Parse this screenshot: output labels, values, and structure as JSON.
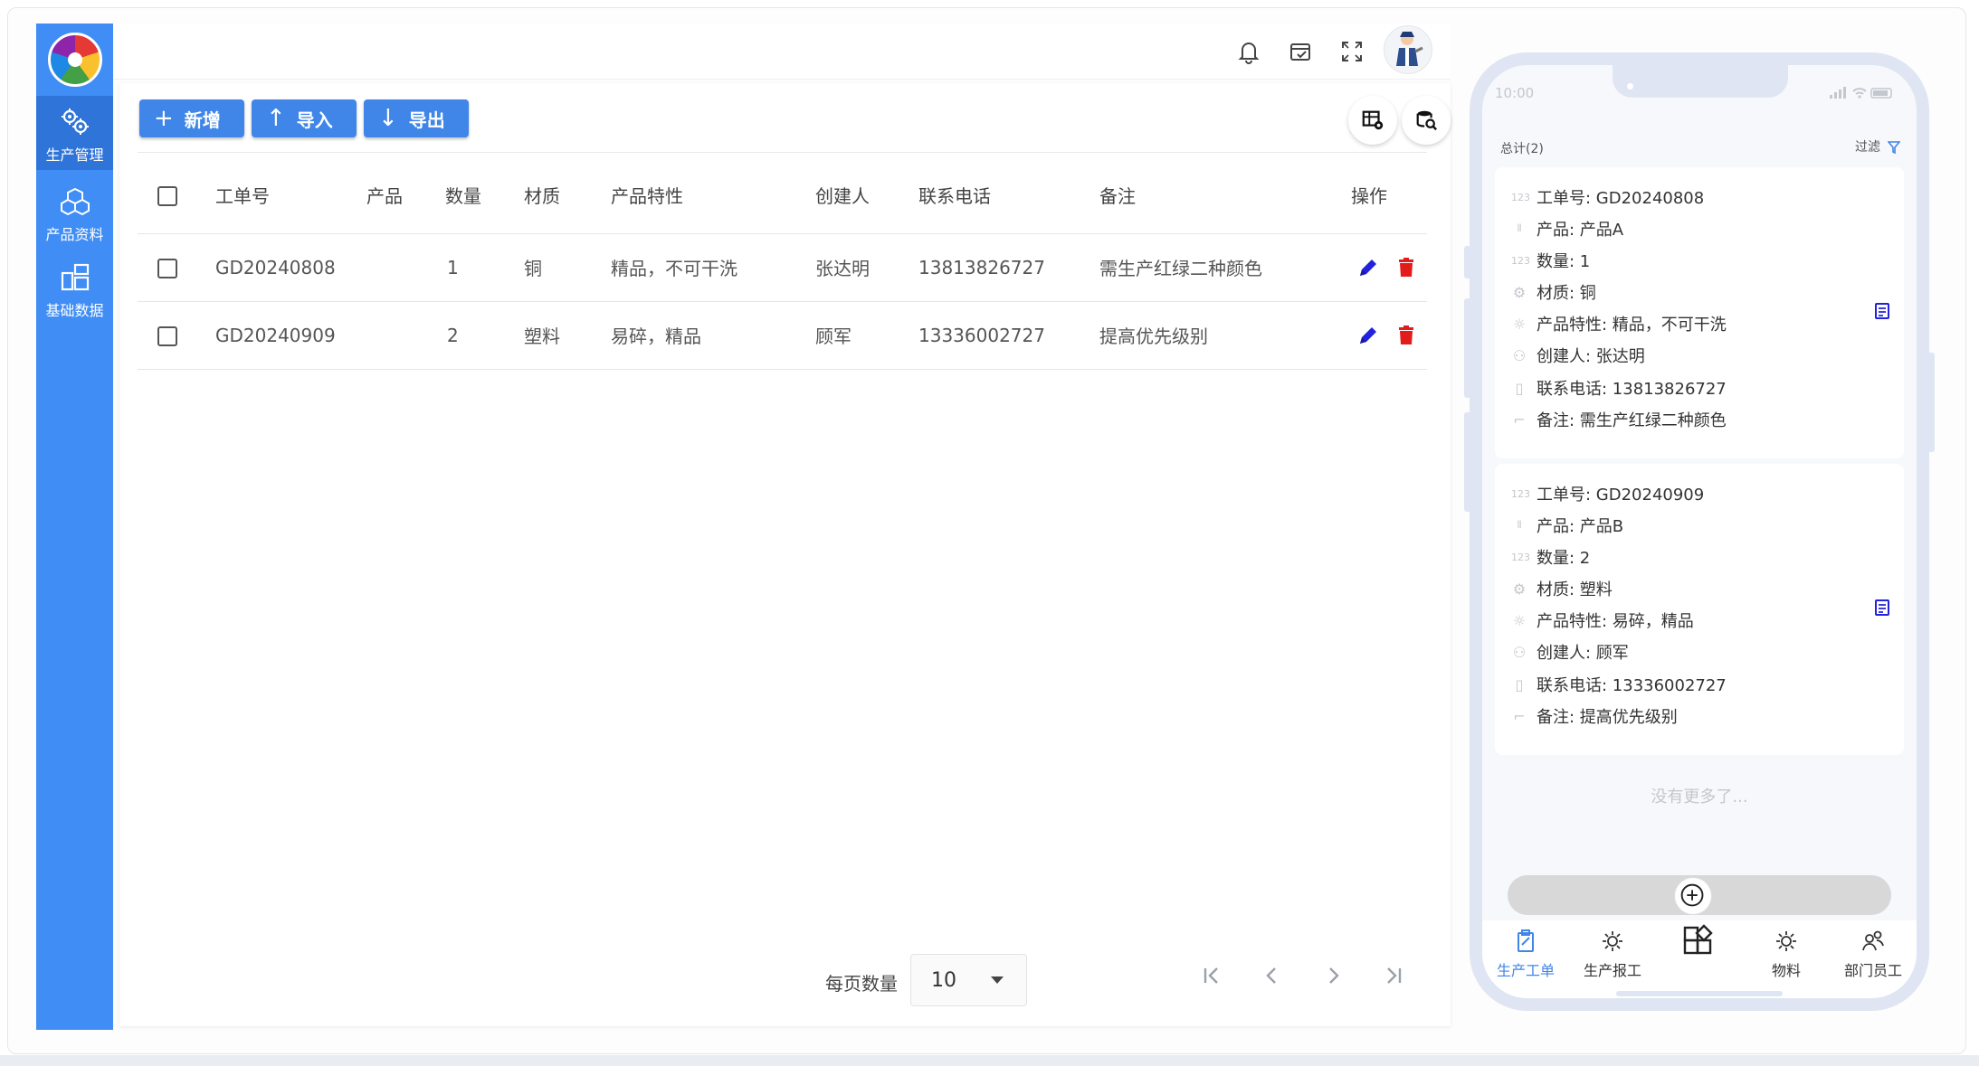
{
  "sidebar": {
    "items": [
      {
        "label": "生产管理",
        "icon": "gears-icon",
        "active": true
      },
      {
        "label": "产品资料",
        "icon": "cubes-icon",
        "active": false
      },
      {
        "label": "基础数据",
        "icon": "blocks-icon",
        "active": false
      }
    ]
  },
  "header": {
    "icons": [
      "bell-icon",
      "tasks-icon",
      "fullscreen-icon"
    ],
    "avatar": "user-avatar"
  },
  "toolbar": {
    "add_label": "新增",
    "import_label": "导入",
    "export_label": "导出",
    "add_icon": "+",
    "import_icon": "↑",
    "export_icon": "↓"
  },
  "table": {
    "headers": [
      "工单号",
      "产品",
      "数量",
      "材质",
      "产品特性",
      "创建人",
      "联系电话",
      "备注",
      "操作"
    ],
    "rows": [
      {
        "order_no": "GD20240808",
        "product": "",
        "qty": "1",
        "material": "铜",
        "feature": "精品，不可干洗",
        "creator": "张达明",
        "phone": "13813826727",
        "note": "需生产红绿二种颜色"
      },
      {
        "order_no": "GD20240909",
        "product": "",
        "qty": "2",
        "material": "塑料",
        "feature": "易碎，精品",
        "creator": "顾军",
        "phone": "13336002727",
        "note": "提高优先级别"
      }
    ]
  },
  "pagination": {
    "per_page_label": "每页数量",
    "per_page_value": "10"
  },
  "mobile": {
    "status_time": "10:00",
    "summary": "总计(2)",
    "filter_label": "过滤",
    "cards": [
      {
        "order_no": "工单号: GD20240808",
        "product": "产品: 产品A",
        "qty": "数量: 1",
        "material": "材质: 铜",
        "feature": "产品特性: 精品，不可干洗",
        "creator": "创建人: 张达明",
        "phone": "联系电话: 13813826727",
        "note": "备注: 需生产红绿二种颜色"
      },
      {
        "order_no": "工单号: GD20240909",
        "product": "产品: 产品B",
        "qty": "数量: 2",
        "material": "材质: 塑料",
        "feature": "产品特性: 易碎，精品",
        "creator": "创建人: 顾军",
        "phone": "联系电话: 13336002727",
        "note": "备注: 提高优先级别"
      }
    ],
    "num_icon_text": "123",
    "no_more": "没有更多了...",
    "tabs": [
      {
        "label": "生产工单",
        "icon": "clipboard-icon",
        "active": true
      },
      {
        "label": "生产报工",
        "icon": "sun-icon",
        "active": false
      },
      {
        "label": "",
        "icon": "apps-icon",
        "active": false
      },
      {
        "label": "物料",
        "icon": "sun-icon",
        "active": false
      },
      {
        "label": "部门员工",
        "icon": "users-icon",
        "active": false
      }
    ]
  },
  "colors": {
    "accent": "#3f86e8",
    "sidebar": "#3f8df5",
    "edit": "#2222dd",
    "delete": "#e21b1b"
  }
}
